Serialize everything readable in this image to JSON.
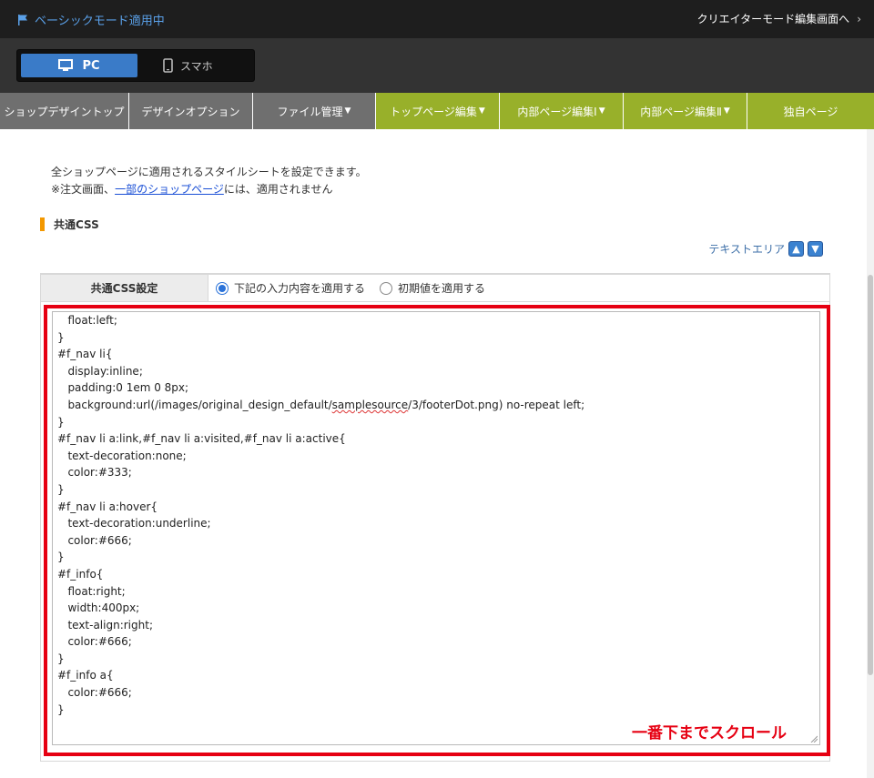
{
  "topbar": {
    "mode_label": "ベーシックモード適用中",
    "creator_link": "クリエイターモード編集画面へ",
    "flag_icon": "flag-icon",
    "chevron_icon": "chevron-right-icon"
  },
  "device": {
    "pc_label": "PC",
    "sp_label": "スマホ",
    "pc_icon": "monitor-icon",
    "sp_icon": "smartphone-icon",
    "active": "PC"
  },
  "nav": {
    "tabs": [
      {
        "label": "ショップデザイントップ",
        "style": "gray"
      },
      {
        "label": "デザインオプション",
        "style": "gray"
      },
      {
        "label": "ファイル管理",
        "style": "gray",
        "caret": "▼"
      },
      {
        "label": "トップページ編集",
        "style": "green",
        "caret": "▼"
      },
      {
        "label": "内部ページ編集Ⅰ",
        "style": "green",
        "caret": "▼"
      },
      {
        "label": "内部ページ編集Ⅱ",
        "style": "green",
        "caret": "▼"
      },
      {
        "label": "独自ページ",
        "style": "green"
      }
    ]
  },
  "intro": {
    "line1": "全ショップページに適用されるスタイルシートを設定できます。",
    "line2_prefix": "※注文画面、",
    "line2_link": "一部のショップページ",
    "line2_suffix": "には、適用されません"
  },
  "section": {
    "title": "共通CSS"
  },
  "textarea_ctrl": {
    "label": "テキストエリア",
    "up_icon": "arrow-up-icon",
    "down_icon": "arrow-down-icon"
  },
  "settings": {
    "label": "共通CSS設定",
    "option_apply": "下記の入力内容を適用する",
    "option_default": "初期値を適用する",
    "selected": "option_apply"
  },
  "editor": {
    "lines": [
      "   float:left;",
      "}",
      "#f_nav li{",
      "   display:inline;",
      "   padding:0 1em 0 8px;",
      "   background:url(/images/original_design_default/samplesource/3/footerDot.png) no-repeat left;",
      "}",
      "#f_nav li a:link,#f_nav li a:visited,#f_nav li a:active{",
      "   text-decoration:none;",
      "   color:#333;",
      "}",
      "#f_nav li a:hover{",
      "   text-decoration:underline;",
      "   color:#666;",
      "}",
      "#f_info{",
      "   float:right;",
      "   width:400px;",
      "   text-align:right;",
      "   color:#666;",
      "}",
      "#f_info a{",
      "   color:#666;",
      "}"
    ]
  },
  "annotation": {
    "scroll_note": "一番下までスクロール",
    "highlight_color": "#e60012"
  },
  "colors": {
    "nav_gray": "#6f6f6f",
    "nav_green": "#98b02a",
    "accent_blue": "#3a7bc8",
    "section_mark": "#f39800"
  }
}
